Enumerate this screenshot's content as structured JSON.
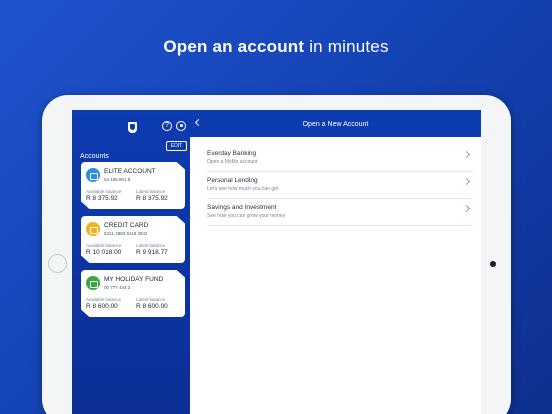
{
  "headline": {
    "bold": "Open an account",
    "rest": "in minutes"
  },
  "sidebar": {
    "edit_label": "EDIT",
    "help_label": "?",
    "accounts_label": "Accounts",
    "balance_labels": {
      "available": "Available balance",
      "latest": "Latest balance"
    },
    "accounts": [
      {
        "name": "ELITE ACCOUNT",
        "number": "04 185 801 8",
        "available": "R 8 375.92",
        "latest": "R 8 375.92",
        "icon": "wallet-icon",
        "color": "#2a8fe0"
      },
      {
        "name": "CREDIT CARD",
        "number": "5221 2883 6118 2842",
        "available": "R 10 018.00",
        "latest": "R 9 918.77",
        "icon": "credit-card-icon",
        "color": "#f2b418"
      },
      {
        "name": "MY HOLIDAY FUND",
        "number": "00 777 444 3",
        "available": "R 8 600.00",
        "latest": "R 8 600.00",
        "icon": "savings-icon",
        "color": "#3aa83e"
      }
    ]
  },
  "main": {
    "title": "Open a New Account",
    "items": [
      {
        "title": "Everday Banking",
        "subtitle": "Open a MyMo account"
      },
      {
        "title": "Personal Lending",
        "subtitle": "Let's see how much you can get"
      },
      {
        "title": "Savings and Investment",
        "subtitle": "See how you can grow your money"
      }
    ]
  },
  "colors": {
    "brand_blue": "#0d3bb0",
    "background_blue": "#1f53cf",
    "chevron": "#6f9be0"
  }
}
